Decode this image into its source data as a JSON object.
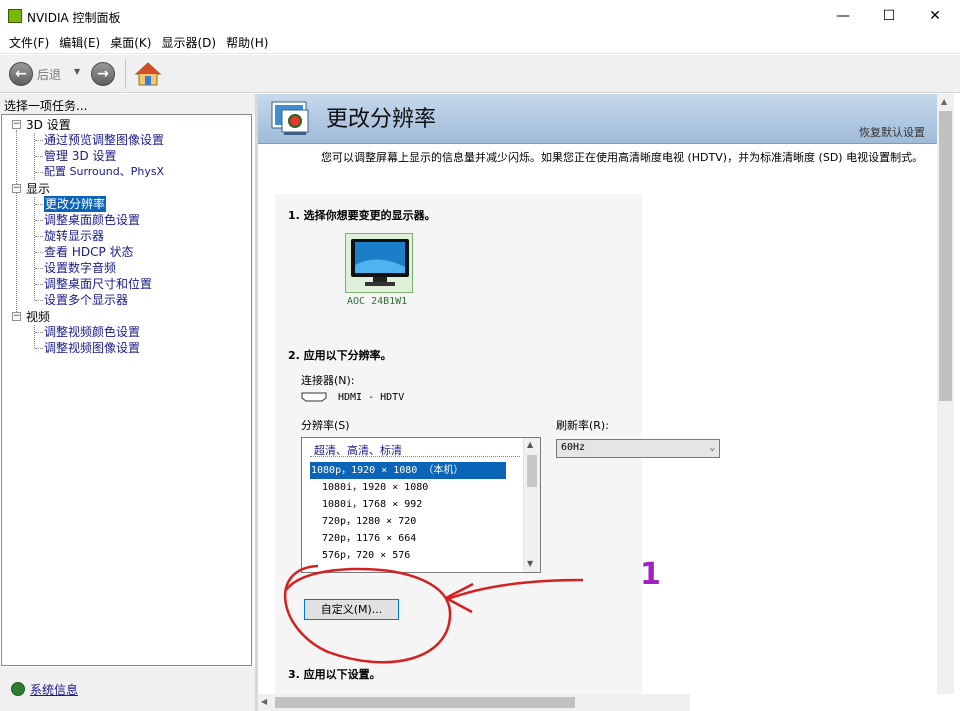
{
  "window": {
    "title": "NVIDIA 控制面板",
    "minimize": "—",
    "maximize": "☐",
    "close": "✕"
  },
  "menu": [
    "文件(F)",
    "编辑(E)",
    "桌面(K)",
    "显示器(D)",
    "帮助(H)"
  ],
  "toolbar": {
    "back_label": "后退"
  },
  "left_panel": {
    "header": "选择一项任务...",
    "tree": [
      {
        "label": "3D 设置",
        "children": [
          "通过预览调整图像设置",
          "管理 3D 设置",
          "配置 Surround、PhysX"
        ]
      },
      {
        "label": "显示",
        "children": [
          "更改分辨率",
          "调整桌面颜色设置",
          "旋转显示器",
          "查看 HDCP 状态",
          "设置数字音频",
          "调整桌面尺寸和位置",
          "设置多个显示器"
        ]
      },
      {
        "label": "视频",
        "children": [
          "调整视频颜色设置",
          "调整视频图像设置"
        ]
      }
    ],
    "selected": "更改分辨率",
    "system_info": "系统信息"
  },
  "right_panel": {
    "title": "更改分辨率",
    "restore_defaults": "恢复默认设置",
    "description": "您可以调整屏幕上显示的信息量并减少闪烁。如果您正在使用高清晰度电视 (HDTV)，并为标准清晰度 (SD) 电视设置制式。",
    "step1": "1. 选择你想要变更的显示器。",
    "monitor_name": "AOC 24B1W1",
    "step2": "2. 应用以下分辨率。",
    "connector_label": "连接器(N):",
    "connector_value": "HDMI - HDTV",
    "resolution_label": "分辨率(S)",
    "refresh_label": "刷新率(R):",
    "refresh_value": "60Hz",
    "resolution_group": "超清、高清、标清",
    "resolutions": [
      "1080p，1920 × 1080 （本机）",
      "1080i，1920 × 1080",
      "1080i，1768 × 992",
      "720p，1280 × 720",
      "720p，1176 × 664",
      "576p，720 × 576"
    ],
    "custom_button": "自定义(M)...",
    "step3": "3. 应用以下设置。"
  },
  "annotation": {
    "label": "1",
    "color": "#d42020",
    "label_color": "#a020c0"
  },
  "colors": {
    "nvidia_green": "#76b900",
    "selection": "#0a64b8",
    "banner": "#b4cce4"
  }
}
